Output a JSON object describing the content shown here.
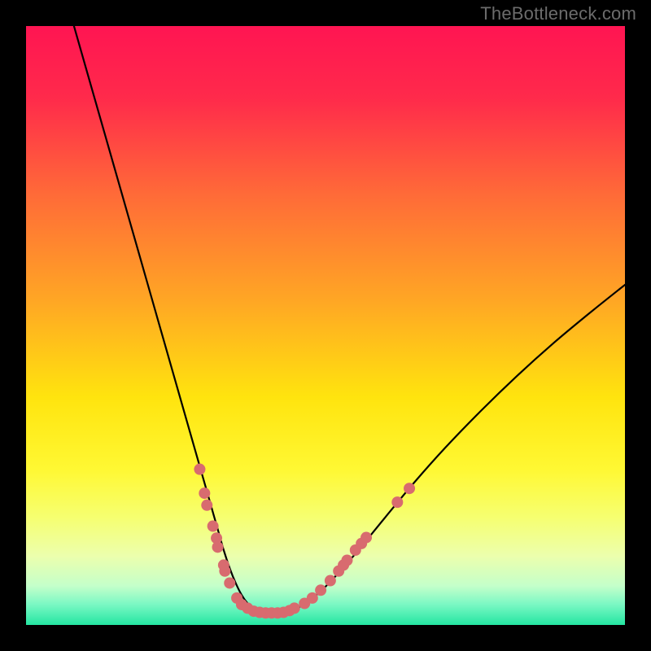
{
  "watermark": "TheBottleneck.com",
  "colors": {
    "bg": "#000000",
    "curve": "#000000",
    "marker_fill": "#d86b6f",
    "marker_stroke": "#d86b6f",
    "gradient_stops": [
      {
        "pos": 0.0,
        "color": "#ff1552"
      },
      {
        "pos": 0.12,
        "color": "#ff2a4b"
      },
      {
        "pos": 0.28,
        "color": "#ff6a38"
      },
      {
        "pos": 0.46,
        "color": "#ffa724"
      },
      {
        "pos": 0.62,
        "color": "#ffe40e"
      },
      {
        "pos": 0.74,
        "color": "#fff833"
      },
      {
        "pos": 0.82,
        "color": "#f6ff70"
      },
      {
        "pos": 0.885,
        "color": "#ecffad"
      },
      {
        "pos": 0.935,
        "color": "#c4ffca"
      },
      {
        "pos": 0.965,
        "color": "#7cf8c4"
      },
      {
        "pos": 1.0,
        "color": "#24e6a2"
      }
    ]
  },
  "chart_data": {
    "type": "line",
    "title": "",
    "xlabel": "",
    "ylabel": "",
    "xlim": [
      0,
      100
    ],
    "ylim": [
      0,
      100
    ],
    "series": [
      {
        "name": "bottleneck-curve",
        "x": [
          8,
          10,
          12,
          14,
          16,
          18,
          20,
          22,
          24,
          26,
          28,
          30,
          32,
          33,
          34,
          35,
          36,
          37,
          38,
          39,
          40,
          42,
          44,
          46,
          48,
          50,
          53,
          56,
          60,
          65,
          70,
          76,
          82,
          88,
          94,
          100
        ],
        "y": [
          100,
          93,
          86,
          79,
          72,
          65,
          58,
          51,
          44,
          37,
          30,
          23,
          16,
          12.5,
          9.5,
          7,
          5,
          3.6,
          2.7,
          2.2,
          2,
          2,
          2.3,
          3.2,
          4.6,
          6.4,
          9.6,
          13.1,
          18,
          24,
          29.6,
          35.8,
          41.6,
          47,
          52,
          56.8
        ]
      }
    ],
    "markers": {
      "name": "marker-dots",
      "points": [
        {
          "x": 29.0,
          "y": 26.0
        },
        {
          "x": 29.8,
          "y": 22.0
        },
        {
          "x": 30.2,
          "y": 20.0
        },
        {
          "x": 31.2,
          "y": 16.5
        },
        {
          "x": 31.8,
          "y": 14.5
        },
        {
          "x": 32.0,
          "y": 13.0
        },
        {
          "x": 33.0,
          "y": 10.0
        },
        {
          "x": 33.2,
          "y": 9.0
        },
        {
          "x": 34.0,
          "y": 7.0
        },
        {
          "x": 35.2,
          "y": 4.5
        },
        {
          "x": 36.0,
          "y": 3.4
        },
        {
          "x": 37.0,
          "y": 2.8
        },
        {
          "x": 38.0,
          "y": 2.3
        },
        {
          "x": 39.0,
          "y": 2.1
        },
        {
          "x": 40.0,
          "y": 2.0
        },
        {
          "x": 41.0,
          "y": 2.0
        },
        {
          "x": 42.0,
          "y": 2.0
        },
        {
          "x": 43.0,
          "y": 2.1
        },
        {
          "x": 44.0,
          "y": 2.4
        },
        {
          "x": 44.8,
          "y": 2.8
        },
        {
          "x": 46.5,
          "y": 3.6
        },
        {
          "x": 47.8,
          "y": 4.5
        },
        {
          "x": 49.2,
          "y": 5.8
        },
        {
          "x": 50.8,
          "y": 7.4
        },
        {
          "x": 52.2,
          "y": 9.0
        },
        {
          "x": 53.0,
          "y": 10.0
        },
        {
          "x": 53.6,
          "y": 10.8
        },
        {
          "x": 55.0,
          "y": 12.5
        },
        {
          "x": 56.0,
          "y": 13.6
        },
        {
          "x": 56.8,
          "y": 14.6
        },
        {
          "x": 62.0,
          "y": 20.5
        },
        {
          "x": 64.0,
          "y": 22.8
        }
      ]
    }
  }
}
